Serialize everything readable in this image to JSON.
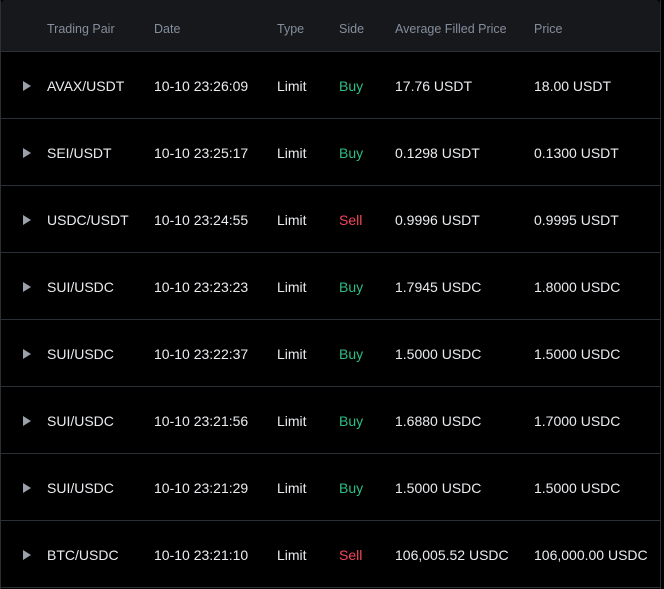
{
  "colors": {
    "background": "#000000",
    "header_background": "#17181c",
    "header_text": "#848e9c",
    "row_text": "#eaecef",
    "divider": "#2b2f36",
    "buy": "#2ebd85",
    "sell": "#f6465d"
  },
  "icons": {
    "expand": "caret-right-icon"
  },
  "columns": {
    "pair": "Trading Pair",
    "date": "Date",
    "type": "Type",
    "side": "Side",
    "avg_price": "Average Filled Price",
    "price": "Price"
  },
  "orders": [
    {
      "pair": "AVAX/USDT",
      "date": "10-10 23:26:09",
      "type": "Limit",
      "side": "Buy",
      "avg_price": "17.76 USDT",
      "price": "18.00 USDT"
    },
    {
      "pair": "SEI/USDT",
      "date": "10-10 23:25:17",
      "type": "Limit",
      "side": "Buy",
      "avg_price": "0.1298 USDT",
      "price": "0.1300 USDT"
    },
    {
      "pair": "USDC/USDT",
      "date": "10-10 23:24:55",
      "type": "Limit",
      "side": "Sell",
      "avg_price": "0.9996 USDT",
      "price": "0.9995 USDT"
    },
    {
      "pair": "SUI/USDC",
      "date": "10-10 23:23:23",
      "type": "Limit",
      "side": "Buy",
      "avg_price": "1.7945 USDC",
      "price": "1.8000 USDC"
    },
    {
      "pair": "SUI/USDC",
      "date": "10-10 23:22:37",
      "type": "Limit",
      "side": "Buy",
      "avg_price": "1.5000 USDC",
      "price": "1.5000 USDC"
    },
    {
      "pair": "SUI/USDC",
      "date": "10-10 23:21:56",
      "type": "Limit",
      "side": "Buy",
      "avg_price": "1.6880 USDC",
      "price": "1.7000 USDC"
    },
    {
      "pair": "SUI/USDC",
      "date": "10-10 23:21:29",
      "type": "Limit",
      "side": "Buy",
      "avg_price": "1.5000 USDC",
      "price": "1.5000 USDC"
    },
    {
      "pair": "BTC/USDC",
      "date": "10-10 23:21:10",
      "type": "Limit",
      "side": "Sell",
      "avg_price": "106,005.52 USDC",
      "price": "106,000.00 USDC"
    }
  ]
}
